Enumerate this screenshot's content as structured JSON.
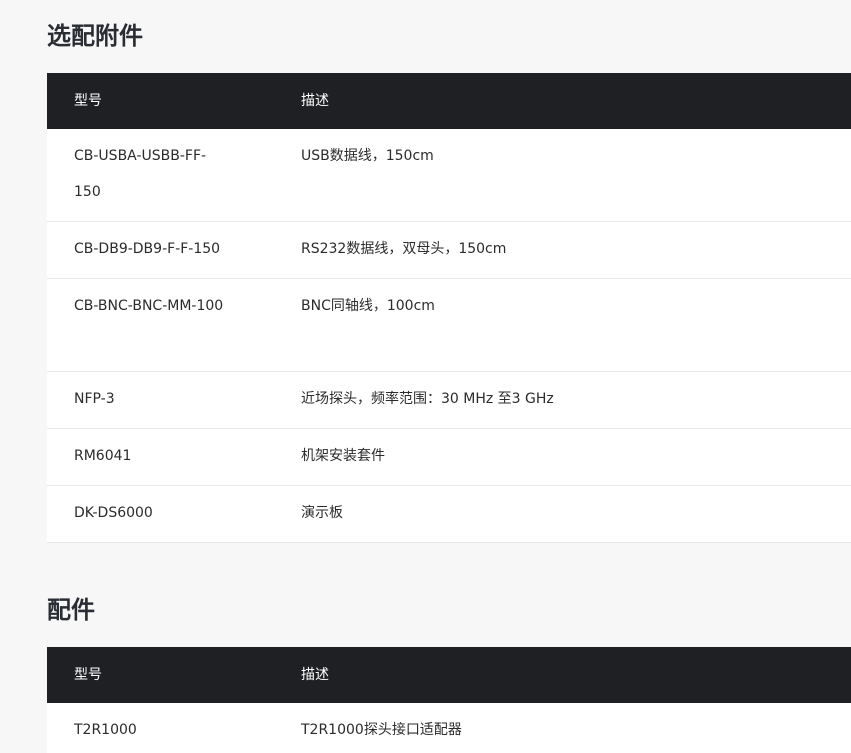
{
  "sections": {
    "optional": {
      "title": "选配附件",
      "headers": {
        "model": "型号",
        "description": "描述"
      },
      "rows": [
        {
          "model": "CB-USBA-USBB-FF-150",
          "description": "USB数据线，150cm"
        },
        {
          "model": "CB-DB9-DB9-F-F-150",
          "description": "RS232数据线，双母头，150cm"
        },
        {
          "model": "CB-BNC-BNC-MM-100",
          "description": "BNC同轴线，100cm"
        },
        {
          "model": "NFP-3",
          "description": "近场探头，频率范围：30 MHz 至3 GHz"
        },
        {
          "model": "RM6041",
          "description": "机架安装套件"
        },
        {
          "model": "DK-DS6000",
          "description": "演示板"
        }
      ]
    },
    "accessories": {
      "title": "配件",
      "headers": {
        "model": "型号",
        "description": "描述"
      },
      "rows": [
        {
          "model": "T2R1000",
          "description": "T2R1000探头接口适配器"
        }
      ]
    }
  }
}
